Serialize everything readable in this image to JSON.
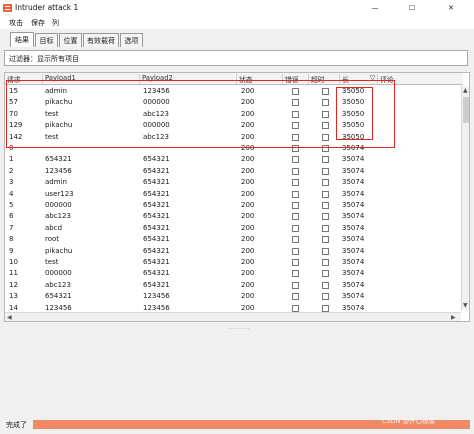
{
  "window": {
    "title": "Intruder attack 1",
    "minimize_glyph": "—",
    "maximize_glyph": "☐",
    "close_glyph": "✕",
    "app_icon": "burp-icon",
    "accent": "#e8623a"
  },
  "menu": [
    "攻击",
    "保存",
    "列"
  ],
  "tabs": [
    {
      "label": "结果",
      "active": true
    },
    {
      "label": "目标",
      "active": false
    },
    {
      "label": "位置",
      "active": false
    },
    {
      "label": "有效载荷",
      "active": false
    },
    {
      "label": "选项",
      "active": false
    }
  ],
  "filter": {
    "text": "过滤器：显示所有项目"
  },
  "table": {
    "columns": [
      "请求",
      "Payload1",
      "Payload2",
      "状态",
      "错误",
      "超时",
      "长",
      "评论"
    ],
    "sorted_column_glyph": "▽",
    "rows": [
      {
        "request": "15",
        "payload1": "admin",
        "payload2": "123456",
        "status": "200",
        "length": "35050"
      },
      {
        "request": "57",
        "payload1": "pikachu",
        "payload2": "000000",
        "status": "200",
        "length": "35050"
      },
      {
        "request": "70",
        "payload1": "test",
        "payload2": "abc123",
        "status": "200",
        "length": "35050"
      },
      {
        "request": "129",
        "payload1": "pikachu",
        "payload2": "000000",
        "status": "200",
        "length": "35050"
      },
      {
        "request": "142",
        "payload1": "test",
        "payload2": "abc123",
        "status": "200",
        "length": "35050"
      },
      {
        "request": "0",
        "payload1": "",
        "payload2": "",
        "status": "200",
        "length": "35074"
      },
      {
        "request": "1",
        "payload1": "654321",
        "payload2": "654321",
        "status": "200",
        "length": "35074"
      },
      {
        "request": "2",
        "payload1": "123456",
        "payload2": "654321",
        "status": "200",
        "length": "35074"
      },
      {
        "request": "3",
        "payload1": "admin",
        "payload2": "654321",
        "status": "200",
        "length": "35074"
      },
      {
        "request": "4",
        "payload1": "user123",
        "payload2": "654321",
        "status": "200",
        "length": "35074"
      },
      {
        "request": "5",
        "payload1": "000000",
        "payload2": "654321",
        "status": "200",
        "length": "35074"
      },
      {
        "request": "6",
        "payload1": "abc123",
        "payload2": "654321",
        "status": "200",
        "length": "35074"
      },
      {
        "request": "7",
        "payload1": "abcd",
        "payload2": "654321",
        "status": "200",
        "length": "35074"
      },
      {
        "request": "8",
        "payload1": "root",
        "payload2": "654321",
        "status": "200",
        "length": "35074"
      },
      {
        "request": "9",
        "payload1": "pikachu",
        "payload2": "654321",
        "status": "200",
        "length": "35074"
      },
      {
        "request": "10",
        "payload1": "test",
        "payload2": "654321",
        "status": "200",
        "length": "35074"
      },
      {
        "request": "11",
        "payload1": "000000",
        "payload2": "654321",
        "status": "200",
        "length": "35074"
      },
      {
        "request": "12",
        "payload1": "abc123",
        "payload2": "654321",
        "status": "200",
        "length": "35074"
      },
      {
        "request": "13",
        "payload1": "654321",
        "payload2": "123456",
        "status": "200",
        "length": "35074"
      },
      {
        "request": "14",
        "payload1": "123456",
        "payload2": "123456",
        "status": "200",
        "length": "35074"
      }
    ],
    "highlight_color": "#e02424"
  },
  "splitter_grip": "·········",
  "status": {
    "text": "完成了",
    "progress": 1.0,
    "progress_color": "#f08a64"
  },
  "watermark": "CSDN @开心极客"
}
